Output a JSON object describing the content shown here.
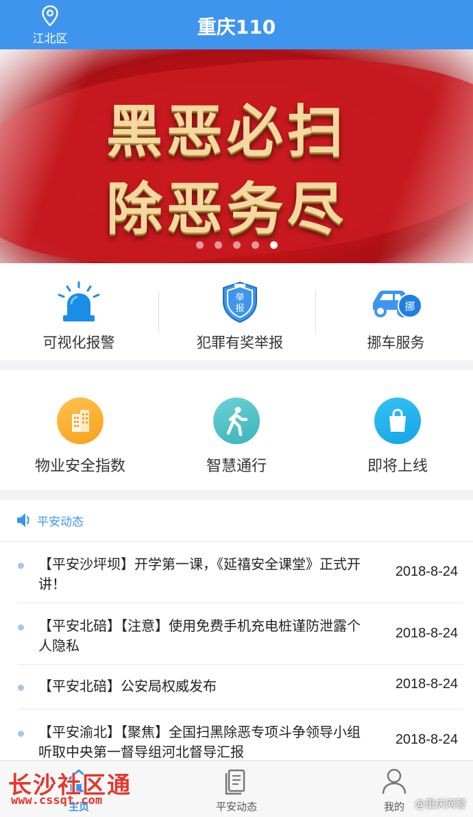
{
  "header": {
    "title": "重庆110",
    "location": "江北区"
  },
  "banner": {
    "slogan_line1": "黑恶必扫",
    "slogan_line2": "除恶务尽",
    "slides_total": 5,
    "active_slide": 5
  },
  "services_row1": [
    {
      "label": "可视化报警",
      "icon": "alarm-light-icon"
    },
    {
      "label": "犯罪有奖举报",
      "icon": "report-badge-icon",
      "badge_text": "举报"
    },
    {
      "label": "挪车服务",
      "icon": "car-move-icon",
      "badge_text": "挪"
    }
  ],
  "services_row2": [
    {
      "label": "物业安全指数",
      "icon": "building-icon"
    },
    {
      "label": "智慧通行",
      "icon": "walking-person-icon"
    },
    {
      "label": "即将上线",
      "icon": "shopping-bag-icon"
    }
  ],
  "news": {
    "section_title": "平安动态",
    "items": [
      {
        "title": "【平安沙坪坝】开学第一课，《延禧安全课堂》正式开讲！",
        "date": "2018-8-24"
      },
      {
        "title": "【平安北碚】【注意】使用免费手机充电桩谨防泄露个人隐私",
        "date": "2018-8-24"
      },
      {
        "title": "【平安北碚】公安局权威发布",
        "date": "2018-8-24"
      },
      {
        "title": "【平安渝北】【聚焦】全国扫黑除恶专项斗争领导小组听取中央第一督导组河北督导汇报",
        "date": "2018-8-24"
      }
    ]
  },
  "tabbar": {
    "home": "主页",
    "news": "平安动态",
    "me": "我的"
  },
  "watermarks": {
    "site_name": "长沙社区通",
    "site_url": "www.cssqt.com",
    "weibo": "@重庆网警"
  },
  "colors": {
    "primary": "#3f95ee",
    "banner_red": "#c5151a",
    "watermark_red": "#e6372c"
  }
}
